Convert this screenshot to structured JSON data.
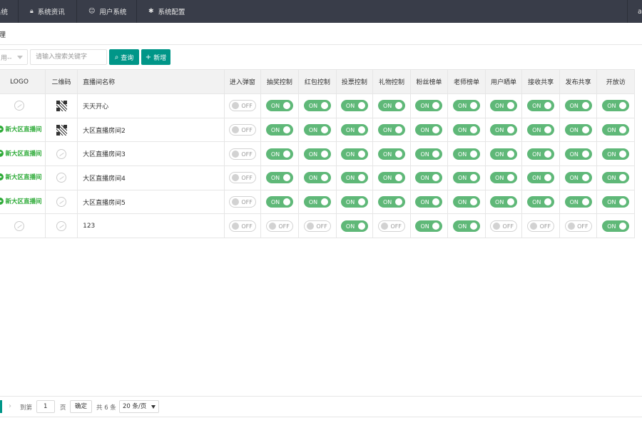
{
  "nav": {
    "brand": "系统",
    "tabs": [
      {
        "label": "系统资讯",
        "icon": "lock-icon"
      },
      {
        "label": "用户系统",
        "icon": "user-icon"
      },
      {
        "label": "系统配置",
        "icon": "gear-icon"
      }
    ],
    "user": "ac"
  },
  "page": {
    "title": "理"
  },
  "toolbar": {
    "filter_value": "用--",
    "search_placeholder": "请输入搜索关键字",
    "query_label": "查询",
    "add_label": "新增"
  },
  "table": {
    "headers": [
      "LOGO",
      "二维码",
      "直播间名称",
      "进入弹窗",
      "抽奖控制",
      "红包控制",
      "投票控制",
      "礼物控制",
      "粉丝榜单",
      "老师榜单",
      "用户晒单",
      "接收共享",
      "发布共享",
      "开放访"
    ],
    "rows": [
      {
        "logo": "placeholder",
        "qr": true,
        "name": "天天开心",
        "switches": [
          "OFF",
          "ON",
          "ON",
          "ON",
          "ON",
          "ON",
          "ON",
          "ON",
          "ON",
          "ON",
          "ON"
        ]
      },
      {
        "logo": "新大区直播间",
        "qr": true,
        "name": "大区直播房间2",
        "switches": [
          "OFF",
          "ON",
          "ON",
          "ON",
          "ON",
          "ON",
          "ON",
          "ON",
          "ON",
          "ON",
          "ON"
        ]
      },
      {
        "logo": "新大区直播间",
        "qr": false,
        "name": "大区直播房间3",
        "switches": [
          "OFF",
          "ON",
          "ON",
          "ON",
          "ON",
          "ON",
          "ON",
          "ON",
          "ON",
          "ON",
          "ON"
        ]
      },
      {
        "logo": "新大区直播间",
        "qr": false,
        "name": "大区直播房间4",
        "switches": [
          "OFF",
          "ON",
          "ON",
          "ON",
          "ON",
          "ON",
          "ON",
          "ON",
          "ON",
          "ON",
          "ON"
        ]
      },
      {
        "logo": "新大区直播间",
        "qr": false,
        "name": "大区直播房间5",
        "switches": [
          "OFF",
          "ON",
          "ON",
          "ON",
          "ON",
          "ON",
          "ON",
          "ON",
          "ON",
          "ON",
          "ON"
        ]
      },
      {
        "logo": "placeholder",
        "qr": false,
        "name": "123",
        "switches": [
          "OFF",
          "OFF",
          "OFF",
          "ON",
          "OFF",
          "ON",
          "ON",
          "OFF",
          "OFF",
          "OFF",
          "ON"
        ]
      }
    ]
  },
  "pager": {
    "goto_label": "到第",
    "page_value": "1",
    "page_unit": "页",
    "confirm_label": "确定",
    "total_label": "共 6 条",
    "page_size": "20 条/页"
  },
  "colors": {
    "accent": "#009688",
    "switch_on": "#5fb878",
    "nav_bg": "#393d49",
    "logo_green": "#2fab39"
  }
}
